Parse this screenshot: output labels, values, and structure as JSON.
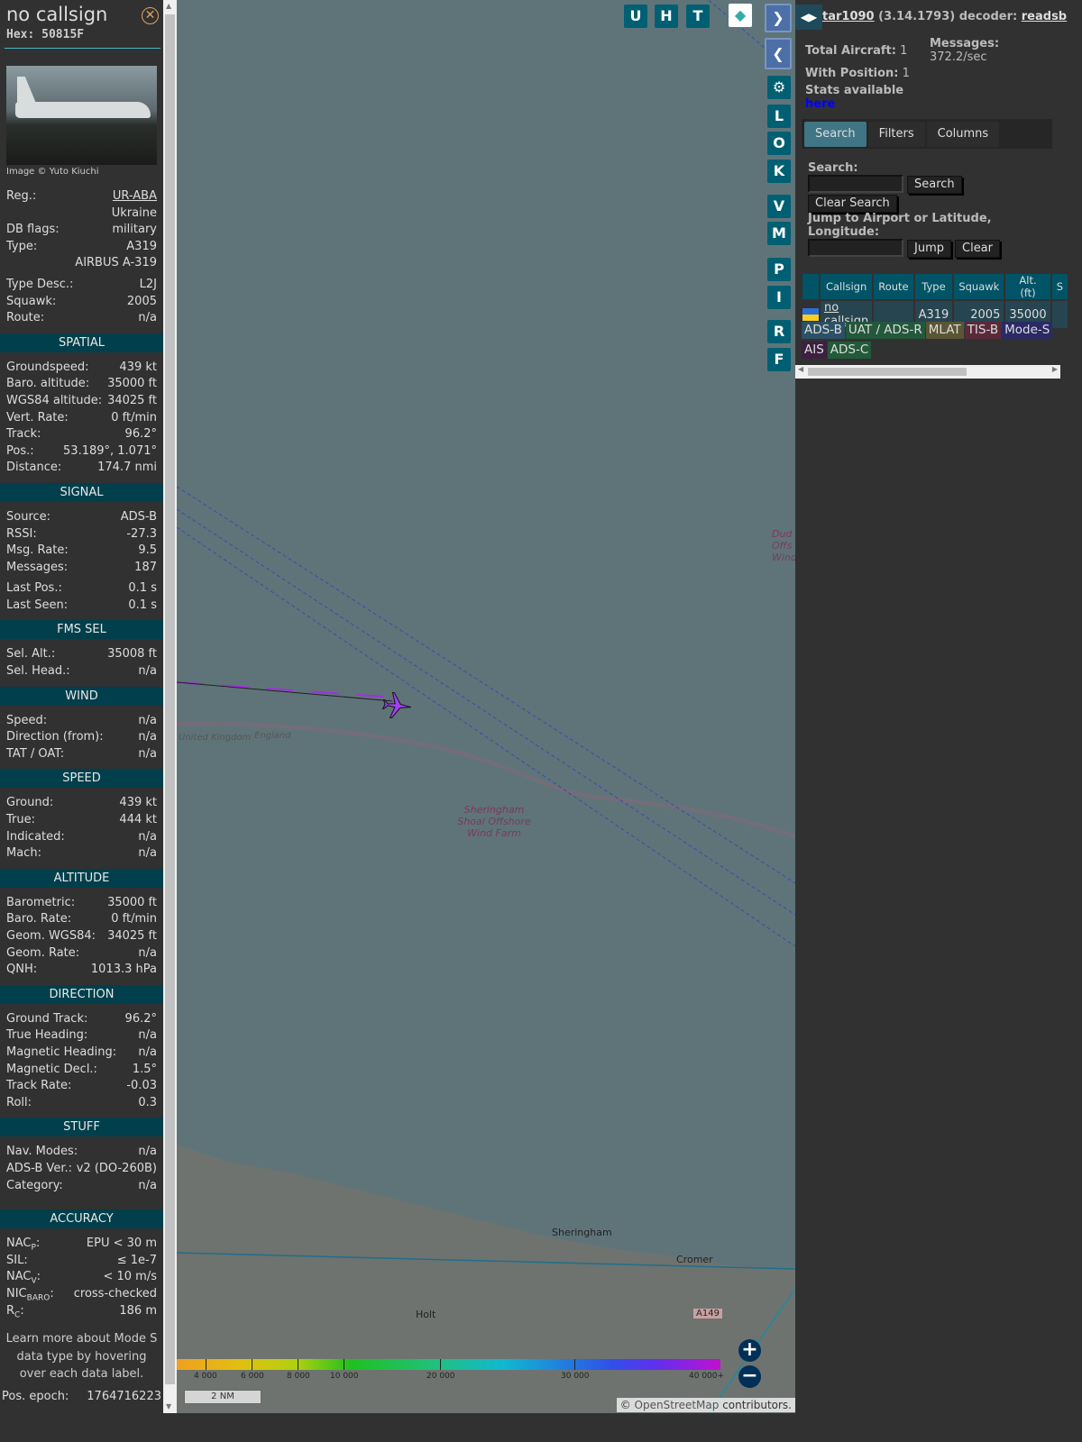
{
  "info": {
    "callsign": "no callsign",
    "hex": "Hex: 50815F",
    "image_credit": "Image © Yuto Kiuchi",
    "top_rows": [
      {
        "l": "Reg.:",
        "v": "UR-ABA",
        "link": true
      },
      {
        "l": "",
        "v": "Ukraine"
      },
      {
        "l": "DB flags:",
        "v": "military"
      },
      {
        "l": "Type:",
        "v": "A319"
      },
      {
        "l": "",
        "v": "AIRBUS A-319"
      },
      {
        "gap": true
      },
      {
        "l": "Type Desc.:",
        "v": "L2J"
      },
      {
        "l": "Squawk:",
        "v": "2005"
      },
      {
        "l": "Route:",
        "v": "n/a"
      }
    ],
    "sections": [
      {
        "title": "SPATIAL",
        "rows": [
          {
            "l": "Groundspeed:",
            "v": "439 kt"
          },
          {
            "l": "Baro. altitude:",
            "v": "35000 ft"
          },
          {
            "l": "WGS84 altitude:",
            "v": "34025 ft"
          },
          {
            "l": "Vert. Rate:",
            "v": "0 ft/min"
          },
          {
            "l": "Track:",
            "v": "96.2°"
          },
          {
            "l": "Pos.:",
            "v": "53.189°, 1.071°"
          },
          {
            "l": "Distance:",
            "v": "174.7 nmi"
          }
        ]
      },
      {
        "title": "SIGNAL",
        "rows": [
          {
            "l": "Source:",
            "v": "ADS-B"
          },
          {
            "l": "RSSI:",
            "v": "-27.3"
          },
          {
            "l": "Msg. Rate:",
            "v": "9.5"
          },
          {
            "l": "Messages:",
            "v": "187"
          },
          {
            "gap": true
          },
          {
            "l": "Last Pos.:",
            "v": "0.1 s"
          },
          {
            "l": "Last Seen:",
            "v": "0.1 s"
          }
        ]
      },
      {
        "title": "FMS SEL",
        "rows": [
          {
            "l": "Sel. Alt.:",
            "v": "35008 ft"
          },
          {
            "l": "Sel. Head.:",
            "v": "n/a"
          }
        ]
      },
      {
        "title": "WIND",
        "rows": [
          {
            "l": "Speed:",
            "v": "n/a"
          },
          {
            "l": "Direction (from):",
            "v": "n/a"
          },
          {
            "l": "TAT / OAT:",
            "v": "n/a"
          }
        ]
      },
      {
        "title": "SPEED",
        "rows": [
          {
            "l": "Ground:",
            "v": "439 kt"
          },
          {
            "l": "True:",
            "v": "444 kt"
          },
          {
            "l": "Indicated:",
            "v": "n/a"
          },
          {
            "l": "Mach:",
            "v": "n/a"
          }
        ]
      },
      {
        "title": "ALTITUDE",
        "rows": [
          {
            "l": "Barometric:",
            "v": "35000 ft"
          },
          {
            "l": "Baro. Rate:",
            "v": "0 ft/min"
          },
          {
            "l": "Geom. WGS84:",
            "v": "34025 ft"
          },
          {
            "l": "Geom. Rate:",
            "v": "n/a"
          },
          {
            "l": "QNH:",
            "v": "1013.3 hPa"
          }
        ]
      },
      {
        "title": "DIRECTION",
        "rows": [
          {
            "l": "Ground Track:",
            "v": "96.2°"
          },
          {
            "l": "True Heading:",
            "v": "n/a"
          },
          {
            "l": "Magnetic Heading:",
            "v": "n/a"
          },
          {
            "l": "Magnetic Decl.:",
            "v": "1.5°"
          },
          {
            "l": "Track Rate:",
            "v": "-0.03"
          },
          {
            "l": "Roll:",
            "v": "0.3"
          }
        ]
      },
      {
        "title": "STUFF",
        "rows": [
          {
            "l": "Nav. Modes:",
            "v": "n/a"
          },
          {
            "l": "ADS-B Ver.:",
            "v": "v2 (DO-260B)"
          },
          {
            "l": "Category:",
            "v": "n/a"
          },
          {
            "gap": true
          },
          {
            "gap": true
          }
        ]
      },
      {
        "title": "ACCURACY",
        "rows": [
          {
            "l": "NAC",
            "sub": "P",
            "v": "EPU < 30 m"
          },
          {
            "l": "SIL:",
            "v": "≤ 1e-7"
          },
          {
            "l": "NAC",
            "sub": "V",
            "v": "< 10 m/s"
          },
          {
            "l": "NIC",
            "sub": "BARO",
            "v": "cross-checked"
          },
          {
            "l": "R",
            "sub": "C",
            "v": "186 m"
          }
        ]
      }
    ],
    "note": "Learn more about Mode S data type by hovering over each data label.",
    "epoch_label": "Pos. epoch:",
    "epoch": "1764716223"
  },
  "map": {
    "buttons_top": [
      "U",
      "H",
      "T"
    ],
    "buttons_side": [
      "L",
      "O",
      "K",
      "V",
      "M",
      "P",
      "I",
      "R",
      "F"
    ],
    "labels": {
      "uk": "United Kingdom",
      "england": "England",
      "wind": "Sheringham Shoal Offshore Wind Farm",
      "dud": "Dud Offs Wind",
      "sheringham": "Sheringham",
      "cromer": "Cromer",
      "holt": "Holt",
      "a149": "A149"
    },
    "colorbar": [
      "4 000",
      "6 000",
      "8 000",
      "10 000",
      "20 000",
      "30 000",
      "40 000+"
    ],
    "scale": "2 NM",
    "attribution_prefix": "©",
    "attribution_link": "OpenStreetMap",
    "attribution_suffix": "contributors."
  },
  "right": {
    "app": "tar1090",
    "version": "(3.14.1793) decoder:",
    "decoder": "readsb",
    "total_label": "Total Aircraft:",
    "total": "1",
    "messages_label": "Messages:",
    "messages": "372.2/sec",
    "withpos_label": "With Position:",
    "withpos": "1",
    "stats_label": "Stats available",
    "stats_link": "here",
    "tabs": [
      "Search",
      "Filters",
      "Columns"
    ],
    "search_label": "Search:",
    "search_btn": "Search",
    "clear_search_btn": "Clear Search",
    "jump_label": "Jump to Airport or Latitude, Longitude:",
    "jump_btn": "Jump",
    "clear_btn": "Clear",
    "columns": [
      "",
      "Callsign",
      "Route",
      "Type",
      "Squawk",
      "Alt. (ft)",
      "S"
    ],
    "row": {
      "callsign": "no callsign",
      "route": "",
      "type": "A319",
      "squawk": "2005",
      "alt": "35000"
    },
    "badges": [
      {
        "t": "ADS-B",
        "c": "#2c5166"
      },
      {
        "t": "UAT / ADS-R",
        "c": "#23583a"
      },
      {
        "t": "MLAT",
        "c": "#5a5534"
      },
      {
        "t": "TIS-B",
        "c": "#5a2a3a"
      },
      {
        "t": "Mode-S",
        "c": "#2a2a66"
      },
      {
        "t": "AIS",
        "c": "#3c2040"
      },
      {
        "t": "ADS-C",
        "c": "#235a3a"
      }
    ]
  }
}
